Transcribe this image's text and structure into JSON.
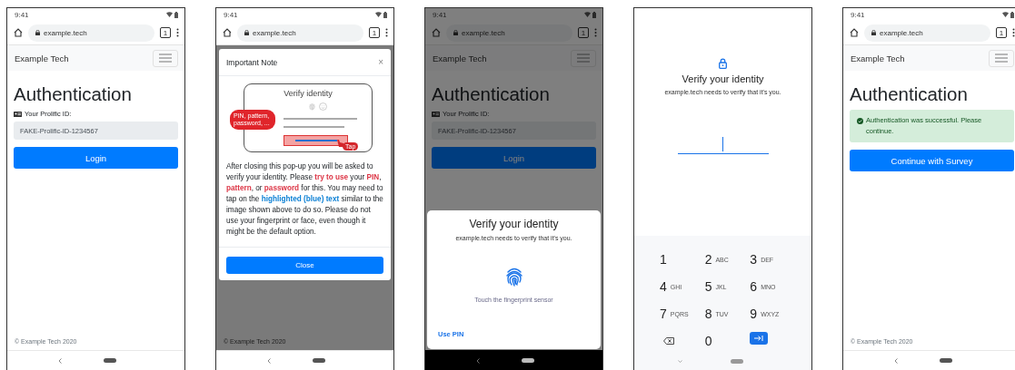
{
  "screens": [
    {
      "kind": "login",
      "status": {
        "time": "9:41"
      },
      "browser": {
        "url": "example.tech",
        "tab_count": "1"
      },
      "brand": "Example Tech",
      "heading": "Authentication",
      "id_label": "Your Prolific ID:",
      "id_value": "FAKE-Prolific-ID-1234567",
      "button": "Login",
      "footer": "© Example Tech 2020"
    },
    {
      "kind": "note",
      "status": {
        "time": "9:41"
      },
      "browser": {
        "url": "example.tech",
        "tab_count": "1"
      },
      "modal": {
        "title": "Important Note",
        "close": "×",
        "illustration": {
          "title": "Verify identity",
          "callout": "PIN, pattern, password, ...",
          "tap": "Tap"
        },
        "paragraph": [
          {
            "kind": "plain",
            "text": "After closing this pop-up you will be asked to verify your identity. Please "
          },
          {
            "kind": "warn",
            "text": "try to use"
          },
          {
            "kind": "plain",
            "text": " your "
          },
          {
            "kind": "warn",
            "text": "PIN"
          },
          {
            "kind": "plain",
            "text": ", "
          },
          {
            "kind": "warn",
            "text": "pattern"
          },
          {
            "kind": "plain",
            "text": ", or "
          },
          {
            "kind": "warn",
            "text": "password"
          },
          {
            "kind": "plain",
            "text": " for this. You may need to tap on the "
          },
          {
            "kind": "info",
            "text": "highlighted (blue) text"
          },
          {
            "kind": "plain",
            "text": " similar to the image shown above to do so. Please do not use your fingerprint or face, even though it might be the default option."
          }
        ],
        "button": "Close"
      },
      "footer": "© Example Tech 2020"
    },
    {
      "kind": "login",
      "status": {
        "time": "9:41"
      },
      "browser": {
        "url": "example.tech",
        "tab_count": "1"
      },
      "brand": "Example Tech",
      "heading": "Authentication",
      "id_label": "Your Prolific ID:",
      "id_value": "FAKE-Prolific-ID-1234567",
      "button": "Login",
      "sheet": {
        "title": "Verify your identity",
        "subtitle": "example.tech needs to verify that it's you.",
        "hint": "Touch the fingerprint sensor",
        "link": "Use PIN"
      }
    },
    {
      "kind": "pin",
      "title": "Verify your identity",
      "subtitle": "example.tech needs to verify that it's you.",
      "keys": [
        {
          "kind": "digit",
          "digit": "1"
        },
        {
          "kind": "digit",
          "digit": "2",
          "letters": "ABC"
        },
        {
          "kind": "digit",
          "digit": "3",
          "letters": "DEF"
        },
        {
          "kind": "digit",
          "digit": "4",
          "letters": "GHI"
        },
        {
          "kind": "digit",
          "digit": "5",
          "letters": "JKL"
        },
        {
          "kind": "digit",
          "digit": "6",
          "letters": "MNO"
        },
        {
          "kind": "digit",
          "digit": "7",
          "letters": "PQRS"
        },
        {
          "kind": "digit",
          "digit": "8",
          "letters": "TUV"
        },
        {
          "kind": "digit",
          "digit": "9",
          "letters": "WXYZ"
        },
        {
          "kind": "backspace"
        },
        {
          "kind": "digit",
          "digit": "0"
        },
        {
          "kind": "enter"
        }
      ]
    },
    {
      "kind": "success",
      "status": {
        "time": "9:41"
      },
      "browser": {
        "url": "example.tech",
        "tab_count": "1"
      },
      "brand": "Example Tech",
      "heading": "Authentication",
      "alert": "Authentication was successful. Please continue.",
      "button": "Continue with Survey",
      "footer": "© Example Tech 2020"
    }
  ]
}
